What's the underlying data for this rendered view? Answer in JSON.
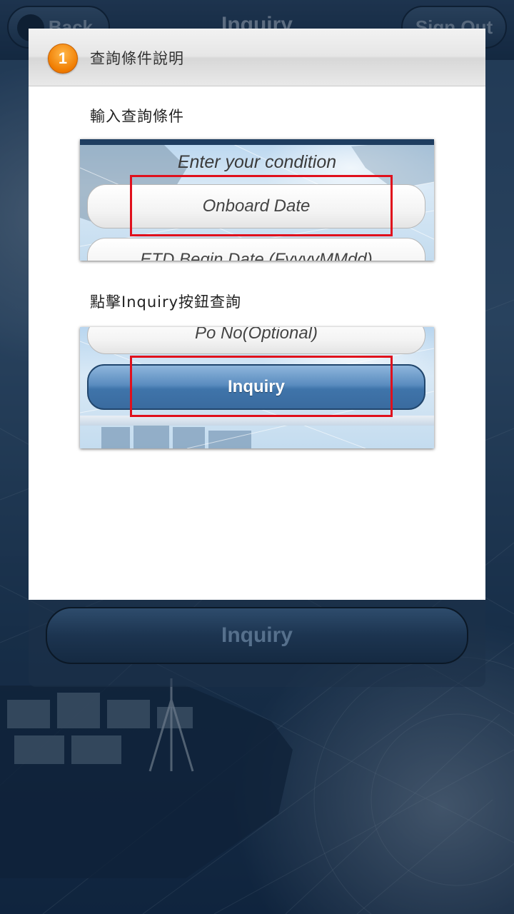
{
  "app": {
    "back_label": "Back",
    "title": "Inquiry",
    "signout_label": "Sign Out",
    "bottom_button_label": "Inquiry"
  },
  "dialog": {
    "step_number": "1",
    "title": "查詢條件說明",
    "instruction_1": "輸入查詢條件",
    "instruction_2": "點擊Inquiry按鈕查詢",
    "screenshot_1": {
      "condition_label": "Enter your condition",
      "field_onboard": "Onboard Date",
      "field_etd": "ETD Begin Date (FyyyyMMdd)"
    },
    "screenshot_2": {
      "field_po": "Po No(Optional)",
      "inquiry_label": "Inquiry"
    }
  },
  "colors": {
    "highlight": "#e0101c",
    "step_badge": "#f07c00",
    "inquiry_button": "#3f74aa"
  },
  "icons": {
    "step_badge": "step-number-icon"
  }
}
